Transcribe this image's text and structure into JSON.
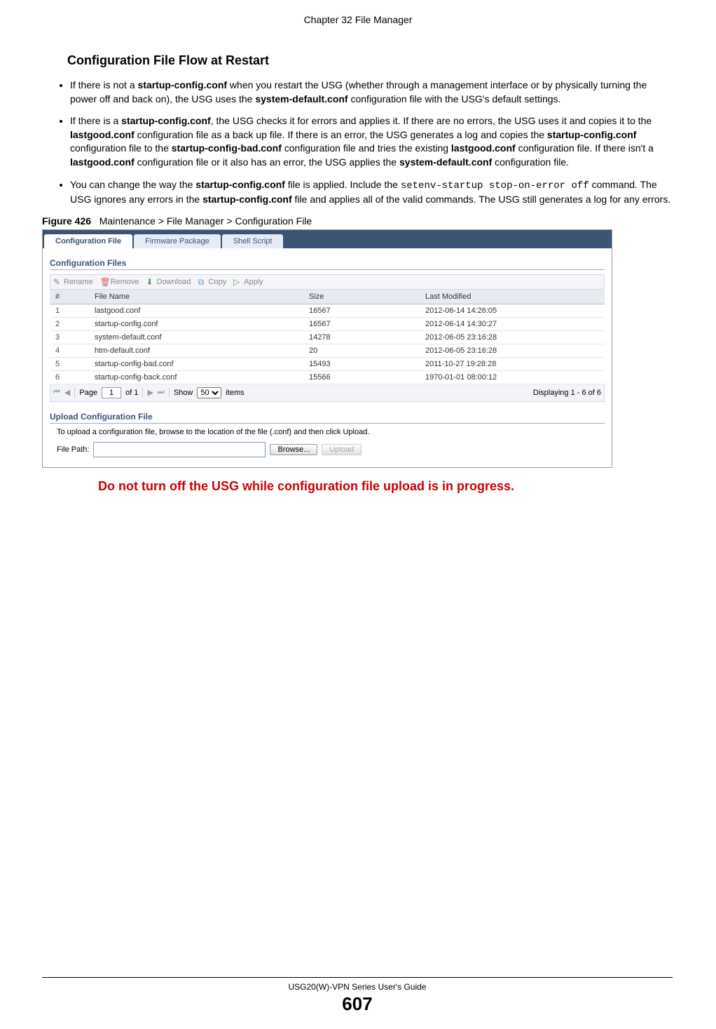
{
  "chapter_heading": "Chapter 32 File Manager",
  "section_title": "Configuration File Flow at Restart",
  "bullets": {
    "b1": {
      "p1": "If there is not a ",
      "b1": "startup-config.conf",
      "p2": " when you restart the USG (whether through a management interface or by physically turning the power off and back on), the USG uses the ",
      "b2": "system-default.conf",
      "p3": " configuration file with the USG's default settings."
    },
    "b2": {
      "p1": "If there is a ",
      "b1": "startup-config.conf",
      "p2": ", the USG checks it for errors and applies it. If there are no errors, the USG uses it and copies it to the ",
      "b2": "lastgood.conf",
      "p3": " configuration file as a back up file. If there is an error, the USG generates a log and copies the ",
      "b3": "startup-config.conf",
      "p4": " configuration file to the ",
      "b4": "startup-config-bad.conf",
      "p5": " configuration file and tries the existing ",
      "b5": "lastgood.conf",
      "p6": " configuration file. If there isn't a ",
      "b6": "lastgood.conf",
      "p7": " configuration file or it also has an error, the USG applies the ",
      "b7": "system-default.conf",
      "p8": " configuration file."
    },
    "b3": {
      "p1": "You can change the way the ",
      "b1": "startup-config.conf",
      "p2": " file is applied. Include the ",
      "c1": "setenv-startup stop-on-error off",
      "p3": " command. The USG ignores any errors in the ",
      "b2": "startup-config.conf",
      "p4": " file and applies all of the valid commands. The USG still generates a log for any errors."
    }
  },
  "figure": {
    "label": "Figure 426",
    "caption": "Maintenance > File Manager > Configuration File"
  },
  "ui": {
    "tabs": [
      "Configuration File",
      "Firmware Package",
      "Shell Script"
    ],
    "section1": "Configuration Files",
    "toolbar": {
      "rename": "Rename",
      "remove": "Remove",
      "download": "Download",
      "copy": "Copy",
      "apply": "Apply"
    },
    "table": {
      "headers": [
        "#",
        "File Name",
        "Size",
        "Last Modified"
      ],
      "rows": [
        {
          "n": "1",
          "name": "lastgood.conf",
          "size": "16567",
          "mod": "2012-06-14 14:26:05"
        },
        {
          "n": "2",
          "name": "startup-config.conf",
          "size": "16567",
          "mod": "2012-06-14 14:30:27"
        },
        {
          "n": "3",
          "name": "system-default.conf",
          "size": "14278",
          "mod": "2012-06-05 23:16:28"
        },
        {
          "n": "4",
          "name": "htm-default.conf",
          "size": "20",
          "mod": "2012-06-05 23:16:28"
        },
        {
          "n": "5",
          "name": "startup-config-bad.conf",
          "size": "15493",
          "mod": "2011-10-27 19:28:28"
        },
        {
          "n": "6",
          "name": "startup-config-back.conf",
          "size": "15566",
          "mod": "1970-01-01 08:00:12"
        }
      ]
    },
    "paging": {
      "page_label": "Page",
      "page": "1",
      "of": "of 1",
      "show_label": "Show",
      "show_value": "50",
      "items": "items",
      "displaying": "Displaying 1 - 6 of 6"
    },
    "section2": "Upload Configuration File",
    "upload_text": "To upload a configuration file, browse to the location of the file (.conf) and then click Upload.",
    "file_path_label": "File Path:",
    "browse": "Browse...",
    "upload": "Upload"
  },
  "warning": "Do not turn off the USG while configuration file upload is in progress.",
  "footer": {
    "guide": "USG20(W)-VPN Series User's Guide",
    "page": "607"
  }
}
